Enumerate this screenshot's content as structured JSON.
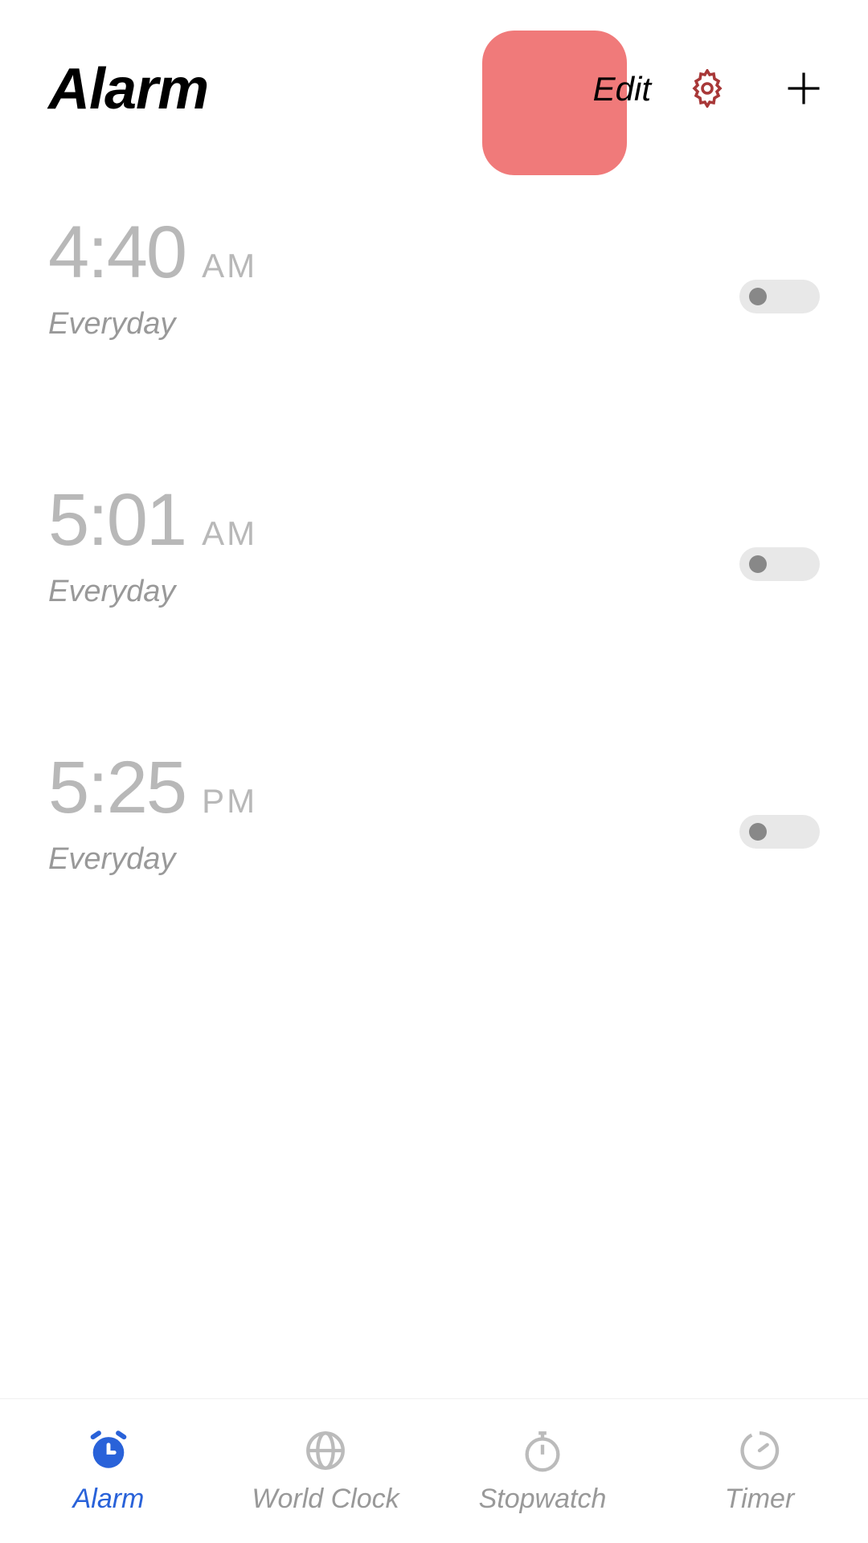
{
  "header": {
    "title": "Alarm",
    "edit_label": "Edit"
  },
  "alarms": [
    {
      "time": "4:40",
      "ampm": "AM",
      "repeat": "Everyday",
      "enabled": false
    },
    {
      "time": "5:01",
      "ampm": "AM",
      "repeat": "Everyday",
      "enabled": false
    },
    {
      "time": "5:25",
      "ampm": "PM",
      "repeat": "Everyday",
      "enabled": false
    }
  ],
  "nav": {
    "items": [
      {
        "label": "Alarm",
        "active": true
      },
      {
        "label": "World Clock",
        "active": false
      },
      {
        "label": "Stopwatch",
        "active": false
      },
      {
        "label": "Timer",
        "active": false
      }
    ]
  },
  "colors": {
    "highlight": "#f07a7a",
    "accent": "#2962d9",
    "inactive_text": "#b8b8b8",
    "subtext": "#999"
  }
}
